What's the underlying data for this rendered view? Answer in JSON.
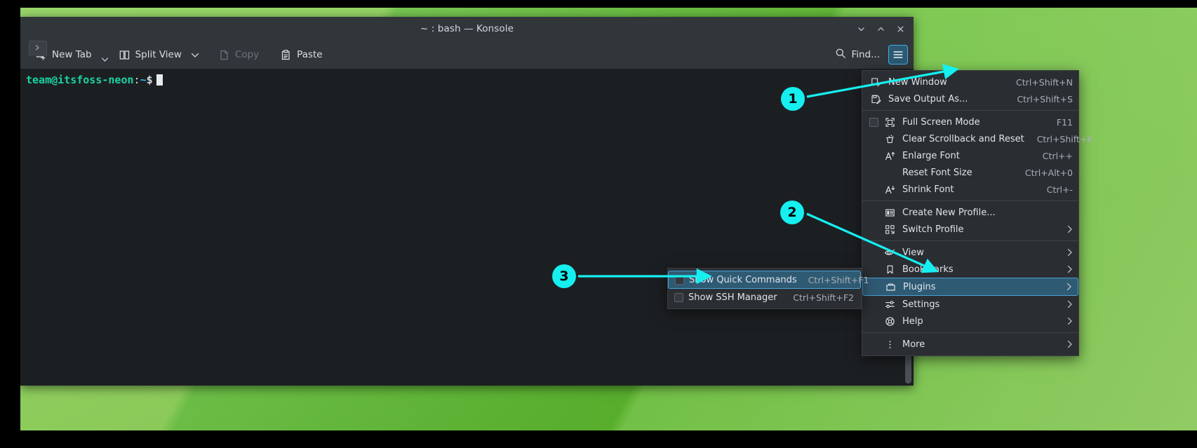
{
  "window": {
    "title": "~ : bash — Konsole",
    "tab_icon": "prompt-icon",
    "controls": [
      {
        "name": "shade-button",
        "icon": "chevron-down-icon"
      },
      {
        "name": "maximize-button",
        "icon": "chevron-up-icon"
      },
      {
        "name": "close-button",
        "icon": "close-icon"
      }
    ]
  },
  "toolbar": {
    "new_tab": "New Tab",
    "split_view": "Split View",
    "copy": "Copy",
    "paste": "Paste",
    "find": "Find...",
    "menu_button_icon": "hamburger-icon",
    "search_icon": "search-icon"
  },
  "terminal": {
    "prompt_user": "team@itsfoss-neon",
    "prompt_colon": ":",
    "prompt_path": "~",
    "prompt_symbol": "$",
    "colors": {
      "background": "#1c1f22",
      "user": "#19d3a2",
      "path": "#2fb9e6",
      "text": "#d6dbe0"
    }
  },
  "main_menu": {
    "groups": [
      {
        "items": [
          {
            "label": "New Window",
            "shortcut": "Ctrl+Shift+N",
            "icon": "new-window-icon",
            "arrow": false,
            "checkbox": false
          },
          {
            "label": "Save Output As...",
            "shortcut": "Ctrl+Shift+S",
            "icon": "save-icon",
            "arrow": false,
            "checkbox": false
          }
        ]
      },
      {
        "items": [
          {
            "label": "Full Screen Mode",
            "shortcut": "F11",
            "icon": "fullscreen-icon",
            "arrow": false,
            "checkbox": true
          },
          {
            "label": "Clear Scrollback and Reset",
            "shortcut": "Ctrl+Shift+K",
            "icon": "clear-scrollback-icon",
            "arrow": false,
            "checkbox": false
          },
          {
            "label": "Enlarge Font",
            "shortcut": "Ctrl++",
            "icon": "enlarge-font-icon",
            "arrow": false,
            "checkbox": false
          },
          {
            "label": "Reset Font Size",
            "shortcut": "Ctrl+Alt+0",
            "icon": "",
            "arrow": false,
            "checkbox": false
          },
          {
            "label": "Shrink Font",
            "shortcut": "Ctrl+-",
            "icon": "shrink-font-icon",
            "arrow": false,
            "checkbox": false
          }
        ]
      },
      {
        "items": [
          {
            "label": "Create New Profile...",
            "shortcut": "",
            "icon": "profile-icon",
            "arrow": false,
            "checkbox": false
          },
          {
            "label": "Switch Profile",
            "shortcut": "",
            "icon": "switch-profile-icon",
            "arrow": true,
            "checkbox": false
          }
        ]
      },
      {
        "items": [
          {
            "label": "View",
            "shortcut": "",
            "icon": "eye-icon",
            "arrow": true,
            "checkbox": false
          },
          {
            "label": "Bookmarks",
            "shortcut": "",
            "icon": "bookmark-icon",
            "arrow": true,
            "checkbox": false
          },
          {
            "label": "Plugins",
            "shortcut": "",
            "icon": "plugins-icon",
            "arrow": true,
            "checkbox": false,
            "highlighted": true
          },
          {
            "label": "Settings",
            "shortcut": "",
            "icon": "settings-icon",
            "arrow": true,
            "checkbox": false
          },
          {
            "label": "Help",
            "shortcut": "",
            "icon": "help-icon",
            "arrow": true,
            "checkbox": false
          }
        ]
      },
      {
        "items": [
          {
            "label": "More",
            "shortcut": "",
            "icon": "more-icon",
            "arrow": true,
            "checkbox": false
          }
        ]
      }
    ]
  },
  "plugins_submenu": {
    "items": [
      {
        "label": "Show Quick Commands",
        "shortcut": "Ctrl+Shift+F1",
        "checkbox": true,
        "checked": false,
        "highlighted": true
      },
      {
        "label": "Show SSH Manager",
        "shortcut": "Ctrl+Shift+F2",
        "checkbox": true,
        "checked": false,
        "highlighted": false
      }
    ]
  },
  "annotations": {
    "accent_color": "#16efef",
    "badges": [
      {
        "number": "1",
        "points_to": "hamburger-menu-button"
      },
      {
        "number": "2",
        "points_to": "plugins-menu-item"
      },
      {
        "number": "3",
        "points_to": "show-quick-commands-item"
      }
    ]
  },
  "desktop": {
    "wallpaper_colors": [
      "#8fd35a",
      "#5cb82f",
      "#9ad86a"
    ]
  }
}
